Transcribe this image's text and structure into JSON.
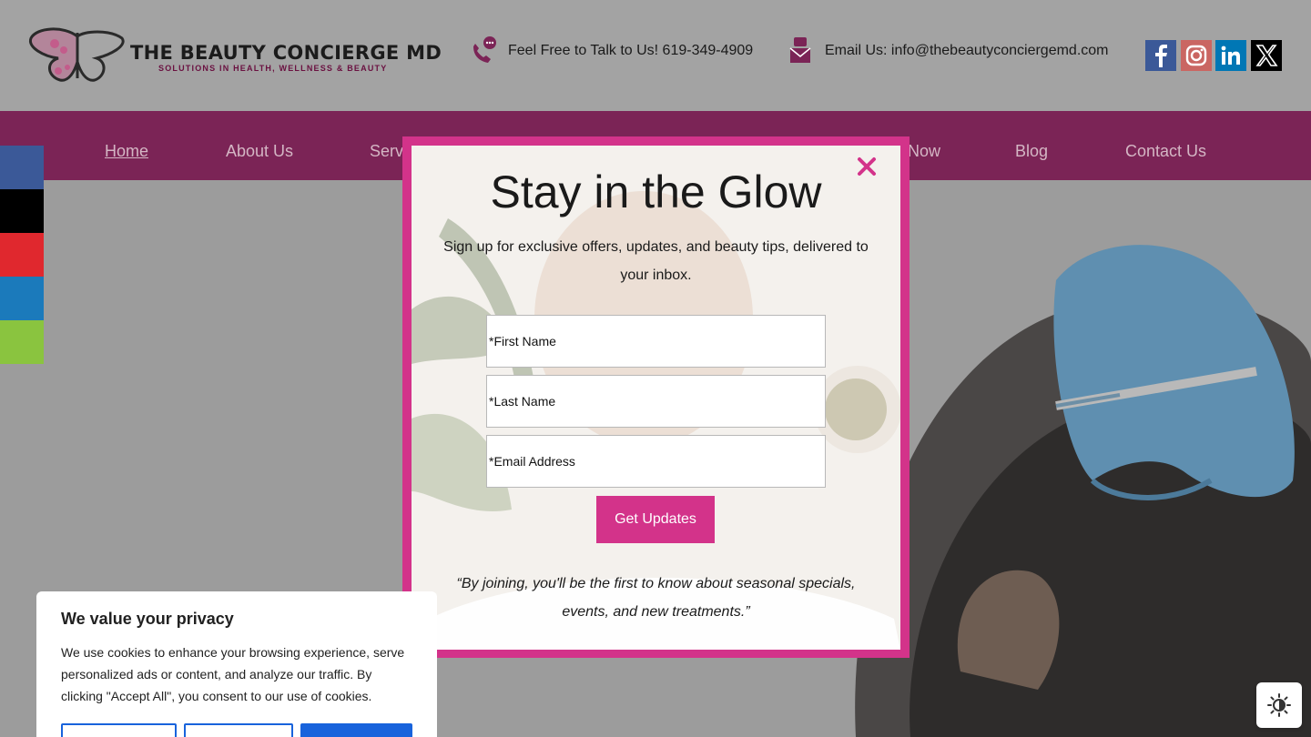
{
  "header": {
    "logo_title": "THE BEAUTY CONCIERGE MD",
    "logo_tagline": "SOLUTIONS IN HEALTH, WELLNESS & BEAUTY",
    "phone_text": "Feel Free to Talk to Us! 619-349-4909",
    "email_text": "Email Us: info@thebeautyconciergemd.com",
    "social": [
      {
        "icon": "facebook-icon",
        "color": "#3b5998"
      },
      {
        "icon": "instagram-icon",
        "color": "#c13584"
      },
      {
        "icon": "linkedin-icon",
        "color": "#0077b5"
      },
      {
        "icon": "x-icon",
        "color": "#000000"
      }
    ]
  },
  "nav": {
    "items": [
      {
        "label": "Home"
      },
      {
        "label": "About Us"
      },
      {
        "label": "Serv"
      },
      {
        "label": "Now"
      },
      {
        "label": "Blog"
      },
      {
        "label": "Contact Us"
      }
    ]
  },
  "share_bar": {
    "colors": [
      "#3b5998",
      "#000000",
      "#e0282e",
      "#1b7abb",
      "#8ac43f"
    ]
  },
  "modal": {
    "title": "Stay in the Glow",
    "subtitle": "Sign up for exclusive offers, updates, and beauty tips, delivered to your inbox.",
    "first_name_placeholder": "*First Name",
    "last_name_placeholder": "*Last Name",
    "email_placeholder": "*Email Address",
    "submit_label": "Get Updates",
    "quote": "“By joining, you'll be the first to know about seasonal specials, events, and new treatments.”",
    "accent_color": "#d3338a"
  },
  "cookie": {
    "title": "We value your privacy",
    "text": "We use cookies to enhance your browsing experience, serve personalized ads or content, and analyze our traffic. By clicking \"Accept All\", you consent to our use of cookies."
  }
}
